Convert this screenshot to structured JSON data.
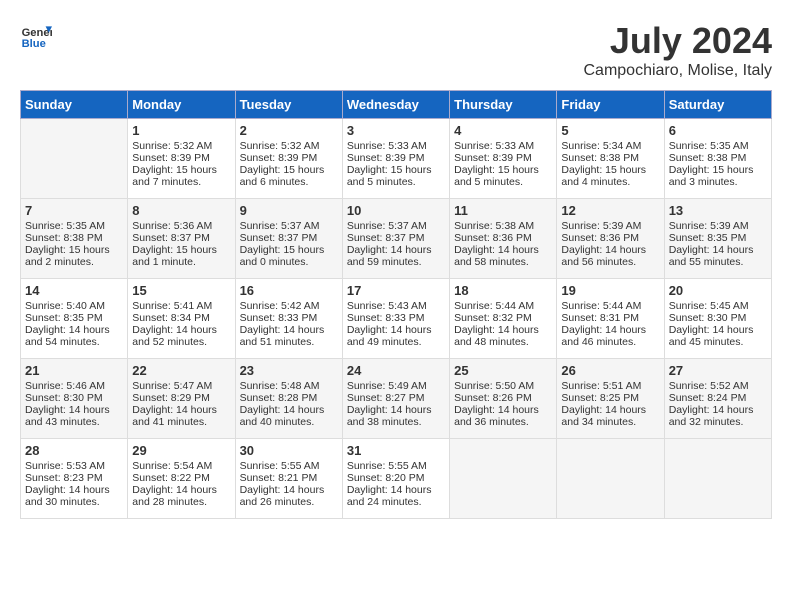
{
  "header": {
    "logo_line1": "General",
    "logo_line2": "Blue",
    "month_year": "July 2024",
    "location": "Campochiaro, Molise, Italy"
  },
  "days_of_week": [
    "Sunday",
    "Monday",
    "Tuesday",
    "Wednesday",
    "Thursday",
    "Friday",
    "Saturday"
  ],
  "weeks": [
    [
      {
        "day": "",
        "empty": true
      },
      {
        "day": "1",
        "sunrise": "Sunrise: 5:32 AM",
        "sunset": "Sunset: 8:39 PM",
        "daylight": "Daylight: 15 hours and 7 minutes."
      },
      {
        "day": "2",
        "sunrise": "Sunrise: 5:32 AM",
        "sunset": "Sunset: 8:39 PM",
        "daylight": "Daylight: 15 hours and 6 minutes."
      },
      {
        "day": "3",
        "sunrise": "Sunrise: 5:33 AM",
        "sunset": "Sunset: 8:39 PM",
        "daylight": "Daylight: 15 hours and 5 minutes."
      },
      {
        "day": "4",
        "sunrise": "Sunrise: 5:33 AM",
        "sunset": "Sunset: 8:39 PM",
        "daylight": "Daylight: 15 hours and 5 minutes."
      },
      {
        "day": "5",
        "sunrise": "Sunrise: 5:34 AM",
        "sunset": "Sunset: 8:38 PM",
        "daylight": "Daylight: 15 hours and 4 minutes."
      },
      {
        "day": "6",
        "sunrise": "Sunrise: 5:35 AM",
        "sunset": "Sunset: 8:38 PM",
        "daylight": "Daylight: 15 hours and 3 minutes."
      }
    ],
    [
      {
        "day": "7",
        "sunrise": "Sunrise: 5:35 AM",
        "sunset": "Sunset: 8:38 PM",
        "daylight": "Daylight: 15 hours and 2 minutes."
      },
      {
        "day": "8",
        "sunrise": "Sunrise: 5:36 AM",
        "sunset": "Sunset: 8:37 PM",
        "daylight": "Daylight: 15 hours and 1 minute."
      },
      {
        "day": "9",
        "sunrise": "Sunrise: 5:37 AM",
        "sunset": "Sunset: 8:37 PM",
        "daylight": "Daylight: 15 hours and 0 minutes."
      },
      {
        "day": "10",
        "sunrise": "Sunrise: 5:37 AM",
        "sunset": "Sunset: 8:37 PM",
        "daylight": "Daylight: 14 hours and 59 minutes."
      },
      {
        "day": "11",
        "sunrise": "Sunrise: 5:38 AM",
        "sunset": "Sunset: 8:36 PM",
        "daylight": "Daylight: 14 hours and 58 minutes."
      },
      {
        "day": "12",
        "sunrise": "Sunrise: 5:39 AM",
        "sunset": "Sunset: 8:36 PM",
        "daylight": "Daylight: 14 hours and 56 minutes."
      },
      {
        "day": "13",
        "sunrise": "Sunrise: 5:39 AM",
        "sunset": "Sunset: 8:35 PM",
        "daylight": "Daylight: 14 hours and 55 minutes."
      }
    ],
    [
      {
        "day": "14",
        "sunrise": "Sunrise: 5:40 AM",
        "sunset": "Sunset: 8:35 PM",
        "daylight": "Daylight: 14 hours and 54 minutes."
      },
      {
        "day": "15",
        "sunrise": "Sunrise: 5:41 AM",
        "sunset": "Sunset: 8:34 PM",
        "daylight": "Daylight: 14 hours and 52 minutes."
      },
      {
        "day": "16",
        "sunrise": "Sunrise: 5:42 AM",
        "sunset": "Sunset: 8:33 PM",
        "daylight": "Daylight: 14 hours and 51 minutes."
      },
      {
        "day": "17",
        "sunrise": "Sunrise: 5:43 AM",
        "sunset": "Sunset: 8:33 PM",
        "daylight": "Daylight: 14 hours and 49 minutes."
      },
      {
        "day": "18",
        "sunrise": "Sunrise: 5:44 AM",
        "sunset": "Sunset: 8:32 PM",
        "daylight": "Daylight: 14 hours and 48 minutes."
      },
      {
        "day": "19",
        "sunrise": "Sunrise: 5:44 AM",
        "sunset": "Sunset: 8:31 PM",
        "daylight": "Daylight: 14 hours and 46 minutes."
      },
      {
        "day": "20",
        "sunrise": "Sunrise: 5:45 AM",
        "sunset": "Sunset: 8:30 PM",
        "daylight": "Daylight: 14 hours and 45 minutes."
      }
    ],
    [
      {
        "day": "21",
        "sunrise": "Sunrise: 5:46 AM",
        "sunset": "Sunset: 8:30 PM",
        "daylight": "Daylight: 14 hours and 43 minutes."
      },
      {
        "day": "22",
        "sunrise": "Sunrise: 5:47 AM",
        "sunset": "Sunset: 8:29 PM",
        "daylight": "Daylight: 14 hours and 41 minutes."
      },
      {
        "day": "23",
        "sunrise": "Sunrise: 5:48 AM",
        "sunset": "Sunset: 8:28 PM",
        "daylight": "Daylight: 14 hours and 40 minutes."
      },
      {
        "day": "24",
        "sunrise": "Sunrise: 5:49 AM",
        "sunset": "Sunset: 8:27 PM",
        "daylight": "Daylight: 14 hours and 38 minutes."
      },
      {
        "day": "25",
        "sunrise": "Sunrise: 5:50 AM",
        "sunset": "Sunset: 8:26 PM",
        "daylight": "Daylight: 14 hours and 36 minutes."
      },
      {
        "day": "26",
        "sunrise": "Sunrise: 5:51 AM",
        "sunset": "Sunset: 8:25 PM",
        "daylight": "Daylight: 14 hours and 34 minutes."
      },
      {
        "day": "27",
        "sunrise": "Sunrise: 5:52 AM",
        "sunset": "Sunset: 8:24 PM",
        "daylight": "Daylight: 14 hours and 32 minutes."
      }
    ],
    [
      {
        "day": "28",
        "sunrise": "Sunrise: 5:53 AM",
        "sunset": "Sunset: 8:23 PM",
        "daylight": "Daylight: 14 hours and 30 minutes."
      },
      {
        "day": "29",
        "sunrise": "Sunrise: 5:54 AM",
        "sunset": "Sunset: 8:22 PM",
        "daylight": "Daylight: 14 hours and 28 minutes."
      },
      {
        "day": "30",
        "sunrise": "Sunrise: 5:55 AM",
        "sunset": "Sunset: 8:21 PM",
        "daylight": "Daylight: 14 hours and 26 minutes."
      },
      {
        "day": "31",
        "sunrise": "Sunrise: 5:55 AM",
        "sunset": "Sunset: 8:20 PM",
        "daylight": "Daylight: 14 hours and 24 minutes."
      },
      {
        "day": "",
        "empty": true
      },
      {
        "day": "",
        "empty": true
      },
      {
        "day": "",
        "empty": true
      }
    ]
  ]
}
